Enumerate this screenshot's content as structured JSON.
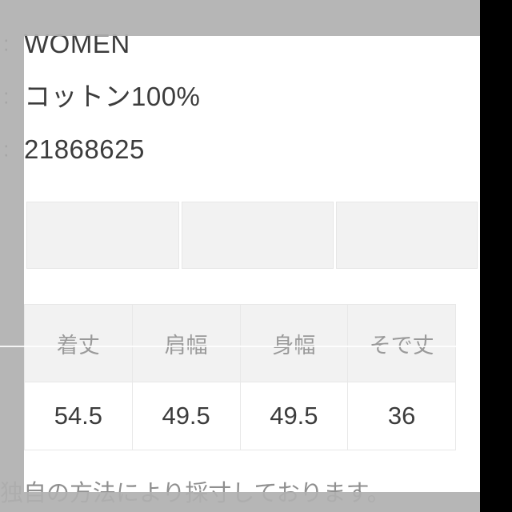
{
  "product_spec": {
    "separator": "：",
    "rows": [
      {
        "colon": ":",
        "value": "WOMEN"
      },
      {
        "colon": ":",
        "value": "コットン100%"
      },
      {
        "colon": ":",
        "value": "21868625"
      }
    ]
  },
  "swatch_row": {
    "cells": [
      "",
      "",
      ""
    ]
  },
  "size_table": {
    "headers": [
      "着丈",
      "肩幅",
      "身幅",
      "そで丈"
    ],
    "rows": [
      [
        "54.5",
        "49.5",
        "49.5",
        "36"
      ]
    ]
  },
  "footer": {
    "note": "独自の方法により採寸しております。"
  },
  "colors": {
    "scrim": "#b0b0b0",
    "panel": "#ffffff",
    "cell_fill": "#f2f2f2",
    "cell_border": "#e8e8e8",
    "text_primary": "#3c3c3c",
    "text_muted": "#9a9a9a",
    "gutter": "#000000"
  }
}
